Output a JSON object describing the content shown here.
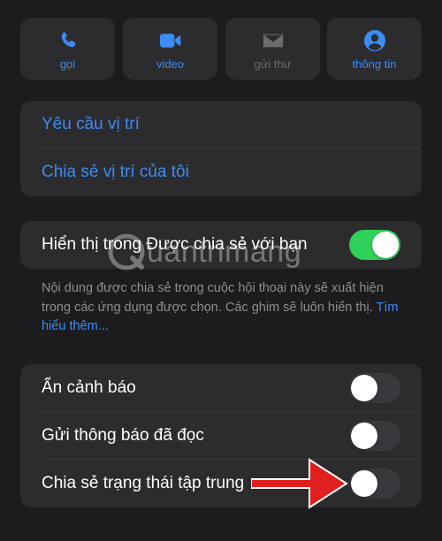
{
  "actions": [
    {
      "label": "gọi",
      "icon": "phone-icon",
      "enabled": true
    },
    {
      "label": "video",
      "icon": "video-camera-icon",
      "enabled": true
    },
    {
      "label": "gửi thư",
      "icon": "envelope-icon",
      "enabled": false
    },
    {
      "label": "thông tin",
      "icon": "person-circle-icon",
      "enabled": true
    }
  ],
  "location": {
    "request_label": "Yêu cầu vị trí",
    "share_label": "Chia sẻ vị trí của tôi"
  },
  "shared_with_you": {
    "label": "Hiển thị trong Được chia sẻ với bạn",
    "enabled": true,
    "note": "Nội dung được chia sẻ trong cuộc hội thoại này sẽ xuất hiện trong các ứng dụng được chọn. Các ghim sẽ luôn hiển thị.",
    "learn_more": "Tìm hiểu thêm..."
  },
  "settings": [
    {
      "label": "Ẩn cảnh báo",
      "enabled": false
    },
    {
      "label": "Gửi thông báo đã đọc",
      "enabled": false
    },
    {
      "label": "Chia sẻ trạng thái tập trung",
      "enabled": false
    }
  ],
  "watermark": "uantrimang",
  "colors": {
    "accent": "#3d8cf5",
    "toggle_on": "#30d158",
    "arrow": "#e02020"
  }
}
